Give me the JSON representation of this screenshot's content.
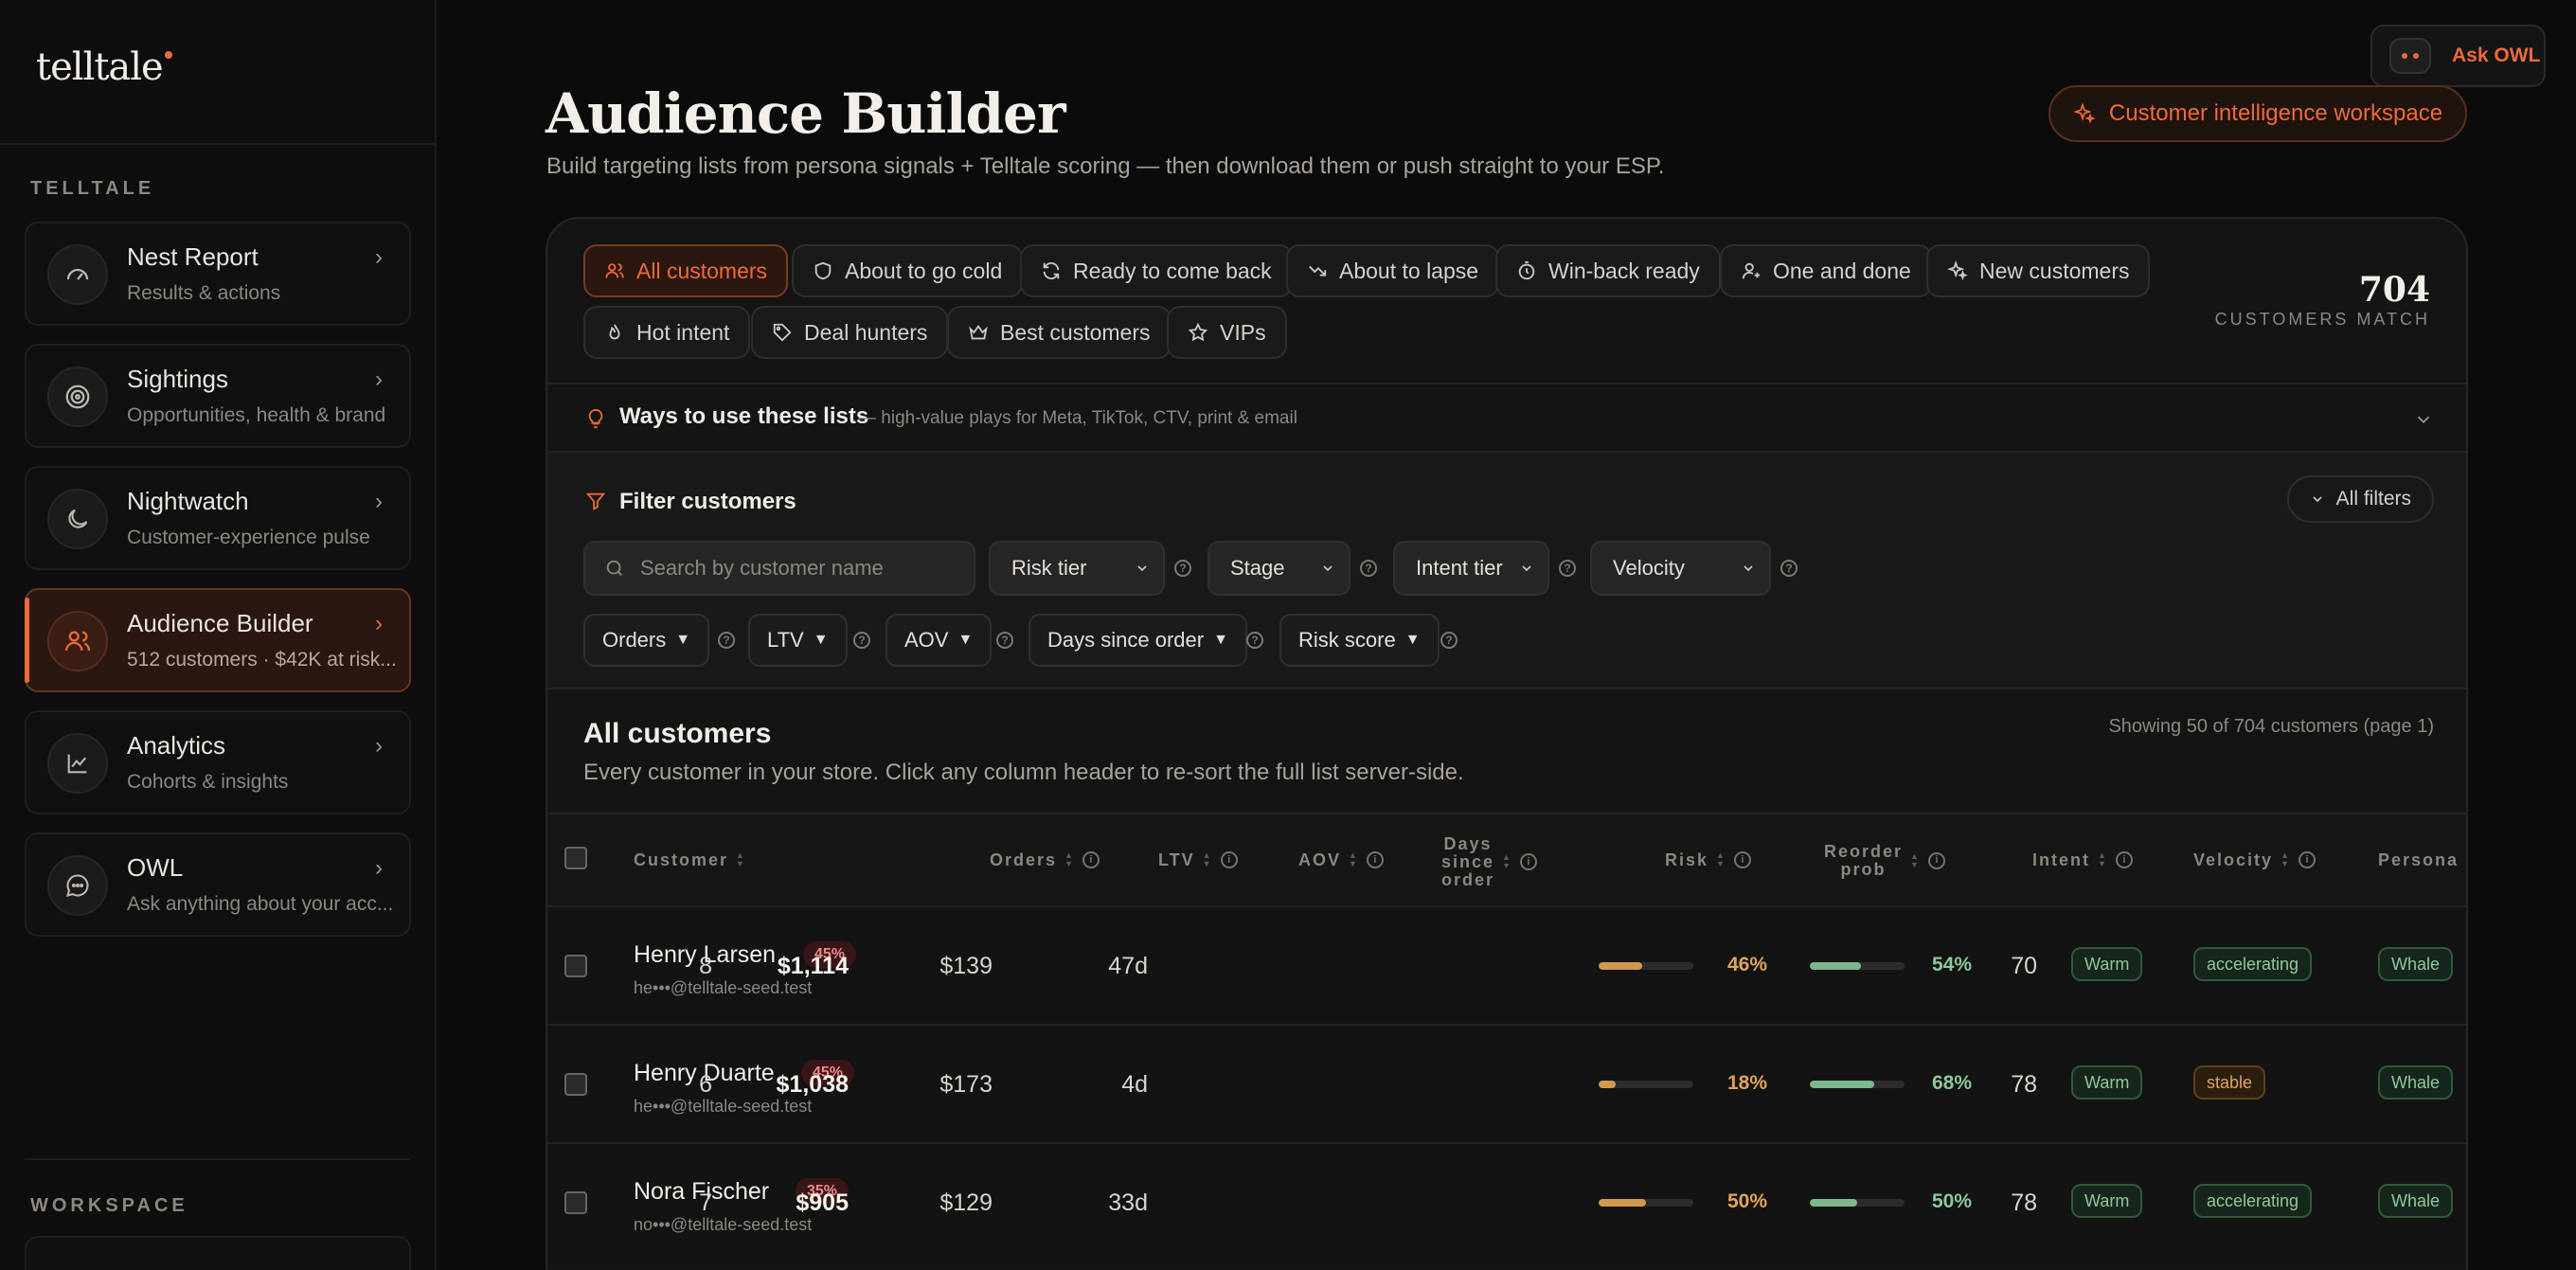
{
  "app": {
    "logo": "telltale"
  },
  "sidebar": {
    "section_label": "TELLTALE",
    "workspace_label": "WORKSPACE",
    "items": [
      {
        "title": "Nest Report",
        "subtitle": "Results & actions",
        "icon": "gauge-icon"
      },
      {
        "title": "Sightings",
        "subtitle": "Opportunities, health & brand",
        "icon": "target-icon"
      },
      {
        "title": "Nightwatch",
        "subtitle": "Customer-experience pulse",
        "icon": "moon-icon"
      },
      {
        "title": "Audience Builder",
        "subtitle": "512 customers · $42K at risk...",
        "icon": "users-icon",
        "active": true
      },
      {
        "title": "Analytics",
        "subtitle": "Cohorts & insights",
        "icon": "chart-line-icon"
      },
      {
        "title": "OWL",
        "subtitle": "Ask anything about your acc...",
        "icon": "chat-icon"
      }
    ]
  },
  "header": {
    "ask_owl": "Ask OWL",
    "title": "Audience Builder",
    "subtitle": "Build targeting lists from persona signals + Telltale scoring — then download them or push straight to your ESP.",
    "workspace_button": "Customer intelligence workspace"
  },
  "segments": [
    {
      "label": "All customers",
      "icon": "users-icon",
      "active": true
    },
    {
      "label": "About to go cold",
      "icon": "shield-icon"
    },
    {
      "label": "Ready to come back",
      "icon": "refresh-icon"
    },
    {
      "label": "About to lapse",
      "icon": "trend-down-icon"
    },
    {
      "label": "Win-back ready",
      "icon": "timer-icon"
    },
    {
      "label": "One and done",
      "icon": "user-plus-icon"
    },
    {
      "label": "New customers",
      "icon": "sparkle-icon"
    },
    {
      "label": "Hot intent",
      "icon": "flame-icon"
    },
    {
      "label": "Deal hunters",
      "icon": "tag-icon"
    },
    {
      "label": "Best customers",
      "icon": "crown-icon"
    },
    {
      "label": "VIPs",
      "icon": "star-icon"
    }
  ],
  "match": {
    "count": "704",
    "label": "CUSTOMERS MATCH"
  },
  "ways": {
    "title": "Ways to use these lists",
    "subtitle": "— high-value plays for Meta, TikTok, CTV, print & email"
  },
  "filters": {
    "title": "Filter customers",
    "all_filters": "All filters",
    "search_placeholder": "Search by customer name",
    "selects": [
      "Risk tier",
      "Stage",
      "Intent tier",
      "Velocity"
    ],
    "ranges": [
      "Orders",
      "LTV",
      "AOV",
      "Days since order",
      "Risk score"
    ]
  },
  "list": {
    "title": "All customers",
    "subtitle": "Every customer in your store. Click any column header to re-sort the full list server-side.",
    "count": "Showing 50 of 704 customers (page 1)",
    "columns": {
      "customer": "Customer",
      "orders": "Orders",
      "ltv": "LTV",
      "aov": "AOV",
      "days": "Days since order",
      "days_l1": "Days",
      "days_l2": "since",
      "days_l3": "order",
      "risk": "Risk",
      "reorder_l1": "Reorder",
      "reorder_l2": "prob",
      "intent": "Intent",
      "velocity": "Velocity",
      "persona": "Persona"
    },
    "rows": [
      {
        "name": "Henry Larsen",
        "email": "he•••@telltale-seed.test",
        "risk_badge": "45%",
        "orders": "8",
        "ltv": "$1,114",
        "aov": "$139",
        "days": "47d",
        "risk_pct": "46%",
        "risk_val": 0.46,
        "reorder_pct": "54%",
        "reorder_val": 0.54,
        "intent": "70",
        "intent_tier": "Warm",
        "velocity": "accelerating",
        "persona": "Whale"
      },
      {
        "name": "Henry Duarte",
        "email": "he•••@telltale-seed.test",
        "risk_badge": "45%",
        "orders": "6",
        "ltv": "$1,038",
        "aov": "$173",
        "days": "4d",
        "risk_pct": "18%",
        "risk_val": 0.18,
        "reorder_pct": "68%",
        "reorder_val": 0.68,
        "intent": "78",
        "intent_tier": "Warm",
        "velocity": "stable",
        "persona": "Whale"
      },
      {
        "name": "Nora Fischer",
        "email": "no•••@telltale-seed.test",
        "risk_badge": "35%",
        "orders": "7",
        "ltv": "$905",
        "aov": "$129",
        "days": "33d",
        "risk_pct": "50%",
        "risk_val": 0.5,
        "reorder_pct": "50%",
        "reorder_val": 0.5,
        "intent": "78",
        "intent_tier": "Warm",
        "velocity": "accelerating",
        "persona": "Whale"
      }
    ]
  },
  "colors": {
    "accent": "#ef6a3a",
    "risk_bar": "#d4974f",
    "reorder_bar": "#7fb78c",
    "risk_text": "#e0a45a",
    "reorder_text": "#8fc79b"
  }
}
